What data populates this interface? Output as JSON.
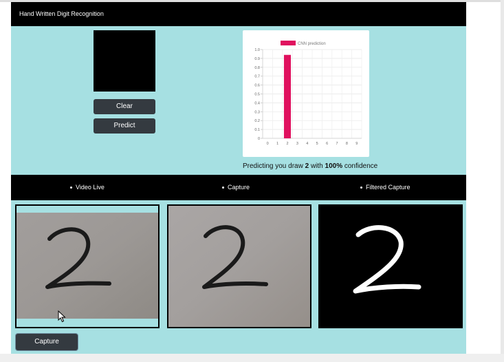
{
  "header": {
    "title": "Hand Written Digit Recognition"
  },
  "draw_panel": {
    "clear_label": "Clear",
    "predict_label": "Predict"
  },
  "chart_data": {
    "type": "bar",
    "legend": "CNN prediction",
    "categories": [
      "0",
      "1",
      "2",
      "3",
      "4",
      "5",
      "6",
      "7",
      "8",
      "9"
    ],
    "values": [
      0,
      0,
      0.94,
      0,
      0,
      0,
      0,
      0,
      0,
      0
    ],
    "ylim": [
      0,
      1.0
    ],
    "yticks": [
      "0",
      "0.1",
      "0.2",
      "0.3",
      "0.4",
      "0.5",
      "0.6",
      "0.7",
      "0.8",
      "0.9",
      "1.0"
    ],
    "bar_color": "#e0115f",
    "legend_position": "top"
  },
  "prediction": {
    "prefix": "Predicting you draw ",
    "digit": "2",
    "middle": " with ",
    "confidence": "100%",
    "suffix": " confidence"
  },
  "nav": {
    "items": [
      {
        "label": "Video Live"
      },
      {
        "label": "Capture"
      },
      {
        "label": "Filtered Capture"
      }
    ]
  },
  "camera": {
    "capture_label": "Capture"
  },
  "colors": {
    "accent": "#a6e0e2",
    "bar": "#e0115f",
    "button": "#343a40"
  }
}
